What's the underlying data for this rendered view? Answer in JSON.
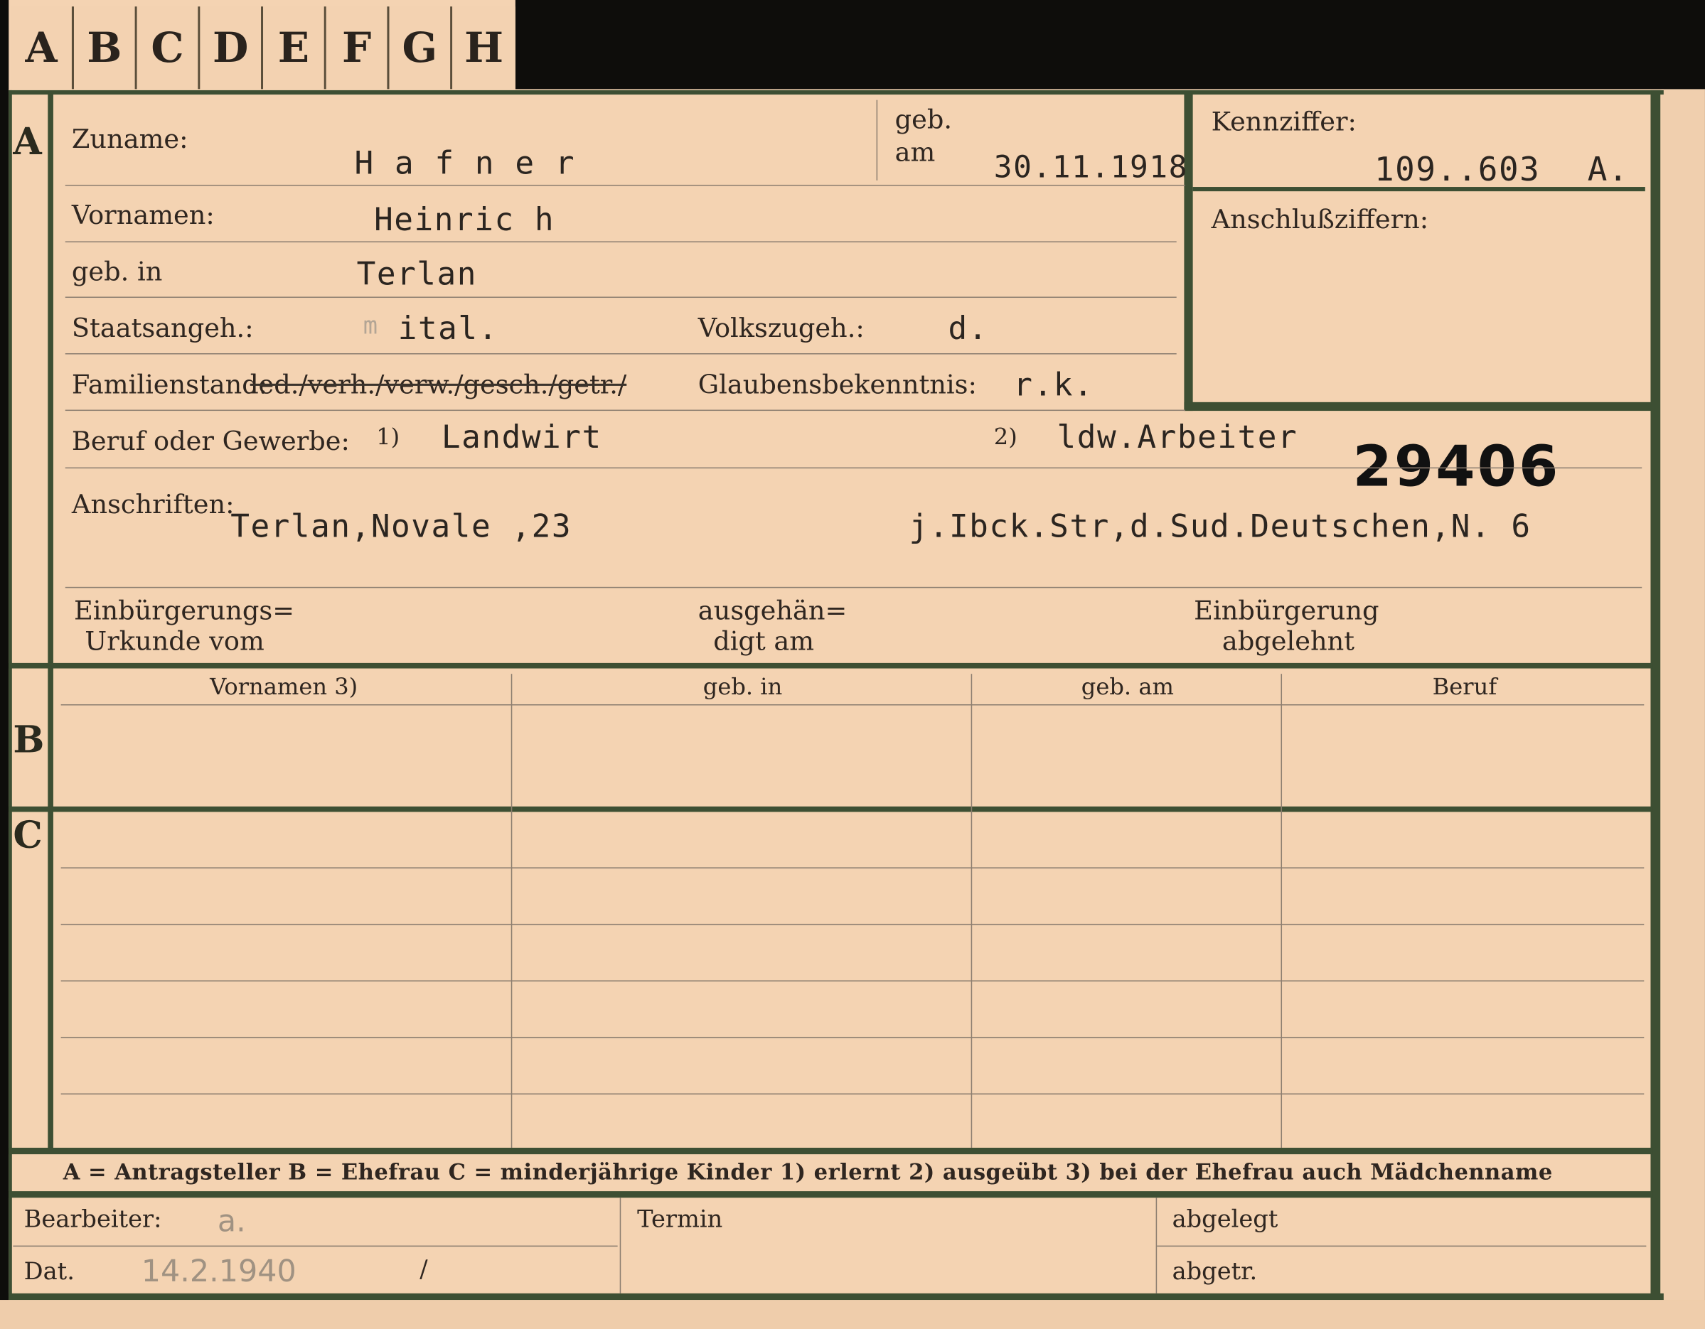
{
  "tabs": [
    "A",
    "B",
    "C",
    "D",
    "E",
    "F",
    "G",
    "H"
  ],
  "section_a": {
    "marker": "A",
    "zuname_label": "Zuname:",
    "zuname_value": "H a f n e r",
    "geb_am_label_1": "geb.",
    "geb_am_label_2": "am",
    "geb_am_value": "30.11.1918",
    "kennziffer_label": "Kennziffer:",
    "kennziffer_value": "109..603",
    "kennziffer_suffix": "A.",
    "anschluss_label": "Anschlußziffern:",
    "vornamen_label": "Vornamen:",
    "vornamen_value": "Heinric h",
    "geb_in_label": "geb. in",
    "geb_in_value": "Terlan",
    "staatsangeh_label": "Staatsangeh.:",
    "staatsangeh_value": "ital.",
    "staatsangeh_prefix": "m",
    "volkszugeh_label": "Volkszugeh.:",
    "volkszugeh_value": "d.",
    "familienstand_label": "Familienstand:",
    "familienstand_options": "led./verh./verw./gesch./getr./",
    "glauben_label": "Glaubensbekenntnis:",
    "glauben_value": "r.k.",
    "beruf_label": "Beruf oder Gewerbe:",
    "beruf_note1": "1)",
    "beruf_value1": "Landwirt",
    "beruf_note2": "2)",
    "beruf_value2": "ldw.Arbeiter",
    "stamp_number": "29406",
    "anschriften_label": "Anschriften:",
    "anschrift1": "Terlan,Novale ,23",
    "anschrift2": "j.Ibck.Str,d.Sud.Deutschen,N. 6",
    "einb_urkunde_1": "Einbürgerungs=",
    "einb_urkunde_2": "Urkunde vom",
    "ausgehaen_1": "ausgehän=",
    "ausgehaen_2": "digt am",
    "einb_abgelehnt_1": "Einbürgerung",
    "einb_abgelehnt_2": "abgelehnt"
  },
  "section_b": {
    "marker": "B",
    "columns": [
      "Vornamen 3)",
      "geb. in",
      "geb. am",
      "Beruf"
    ]
  },
  "section_c": {
    "marker": "C"
  },
  "legend": "A = Antragsteller   B = Ehefrau   C = minderjährige Kinder   1) erlernt   2) ausgeübt   3) bei der Ehefrau auch Mädchenname",
  "footer": {
    "bearbeiter_label": "Bearbeiter:",
    "bearbeiter_value": "a.",
    "dat_label": "Dat.",
    "dat_value": "14.2.1940",
    "dat_slash": "/",
    "termin_label": "Termin",
    "abgelegt_label": "abgelegt",
    "abgetr_label": "abgetr."
  },
  "colors": {
    "card": "#f4d3b2",
    "border": "#3d4f33",
    "background": "#0e0d0b"
  }
}
